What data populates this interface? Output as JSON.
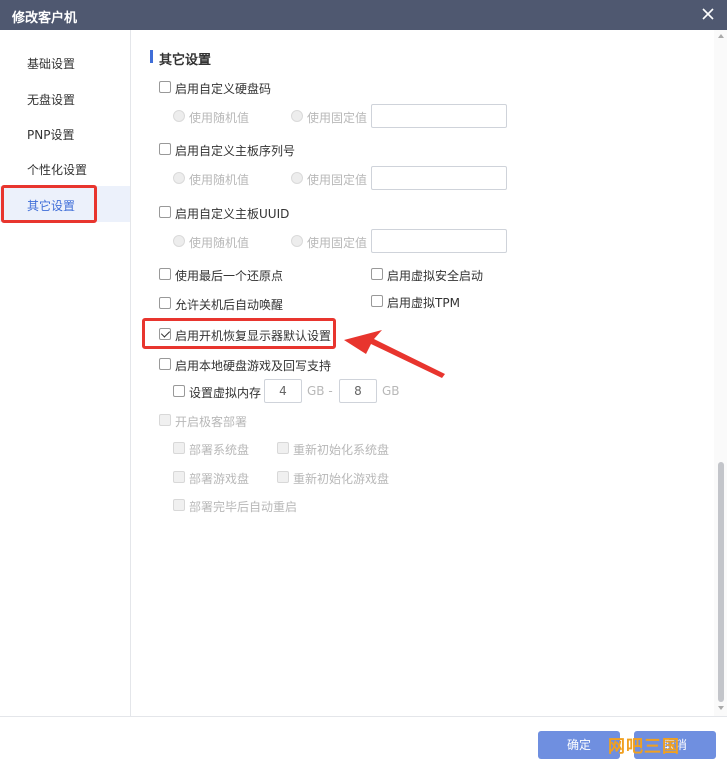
{
  "window": {
    "title": "修改客户机",
    "close_icon": "close-icon"
  },
  "sidebar": {
    "items": [
      {
        "label": "基础设置"
      },
      {
        "label": "无盘设置"
      },
      {
        "label": "PNP设置"
      },
      {
        "label": "个性化设置"
      },
      {
        "label": "其它设置",
        "active": true
      }
    ]
  },
  "section": {
    "title": "其它设置"
  },
  "options": {
    "custom_disk_code": {
      "label": "启用自定义硬盘码",
      "checked": false,
      "random": "使用随机值",
      "fixed": "使用固定值",
      "value": ""
    },
    "custom_board_serial": {
      "label": "启用自定义主板序列号",
      "checked": false,
      "random": "使用随机值",
      "fixed": "使用固定值",
      "value": ""
    },
    "custom_board_uuid": {
      "label": "启用自定义主板UUID",
      "checked": false,
      "random": "使用随机值",
      "fixed": "使用固定值",
      "value": ""
    },
    "use_last_restore": {
      "label": "使用最后一个还原点",
      "checked": false
    },
    "virtual_secure_boot": {
      "label": "启用虚拟安全启动",
      "checked": false
    },
    "allow_wake": {
      "label": "允许关机后自动唤醒",
      "checked": false
    },
    "virtual_tpm": {
      "label": "启用虚拟TPM",
      "checked": false
    },
    "restore_display": {
      "label": "启用开机恢复显示器默认设置",
      "checked": true
    },
    "local_disk_game": {
      "label": "启用本地硬盘游戏及回写支持",
      "checked": false
    },
    "virtual_memory": {
      "label": "设置虚拟内存",
      "checked": false,
      "min": "4",
      "min_unit": "GB -",
      "max": "8",
      "max_unit": "GB"
    },
    "fast_deploy": {
      "label": "开启极客部署",
      "checked": false
    },
    "deploy_system": {
      "label": "部署系统盘"
    },
    "reinit_system": {
      "label": "重新初始化系统盘"
    },
    "deploy_game": {
      "label": "部署游戏盘"
    },
    "reinit_game": {
      "label": "重新初始化游戏盘"
    },
    "auto_restart": {
      "label": "部署完毕后自动重启"
    }
  },
  "footer": {
    "ok_label": "确定",
    "cancel_label": "取消"
  },
  "watermark": "网吧三国",
  "colors": {
    "accent": "#3f6ed8",
    "titlebar": "#4f5870",
    "highlight": "#e8352e"
  }
}
